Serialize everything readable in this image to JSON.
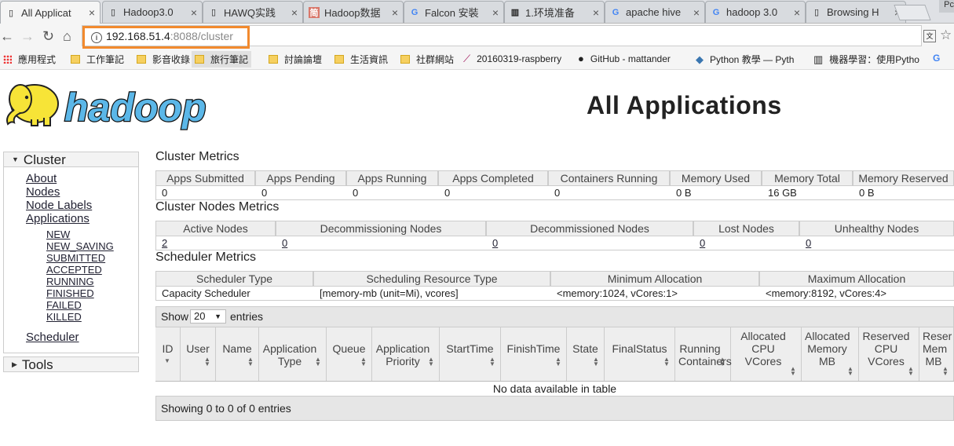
{
  "tabs": [
    {
      "label": "All Applicat",
      "icon": "page-icon",
      "active": true
    },
    {
      "label": "Hadoop3.0",
      "icon": "page-icon"
    },
    {
      "label": "HAWQ实践",
      "icon": "page-icon"
    },
    {
      "label": "Hadoop数据",
      "icon": "jian-site-icon",
      "icon_text": "简"
    },
    {
      "label": "Falcon 安裝",
      "icon": "google-icon",
      "icon_text": "G"
    },
    {
      "label": "1.环境准备",
      "icon": "book-icon"
    },
    {
      "label": "apache hive",
      "icon": "google-icon",
      "icon_text": "G"
    },
    {
      "label": "hadoop 3.0",
      "icon": "google-icon",
      "icon_text": "G"
    },
    {
      "label": "Browsing H",
      "icon": "page-icon"
    }
  ],
  "window_corner_label": "Pc",
  "address_bar": {
    "host": "192.168.51.4",
    "rest": ":8088/cluster"
  },
  "bookmarks": [
    {
      "label": "應用程式",
      "icon": "apps-icon"
    },
    {
      "label": "工作筆記",
      "icon": "folder-icon"
    },
    {
      "label": "影音收錄",
      "icon": "folder-icon"
    },
    {
      "label": "旅行筆記",
      "icon": "folder-icon",
      "selected": true
    },
    {
      "label": "討論論壇",
      "icon": "folder-icon"
    },
    {
      "label": "生活資訊",
      "icon": "folder-icon"
    },
    {
      "label": "社群網站",
      "icon": "folder-icon"
    },
    {
      "label": "20160319-raspberry",
      "icon": "feather-icon"
    },
    {
      "label": "GitHub - mattander",
      "icon": "github-icon"
    },
    {
      "label": "Python 教學 — Pyth",
      "icon": "python-icon"
    },
    {
      "label": "機器學習：使用Pytho",
      "icon": "book-icon"
    }
  ],
  "logo_text": "hadoop",
  "page_title": "All Applications",
  "sidebar": {
    "cluster_header": "Cluster",
    "links": [
      "About",
      "Nodes",
      "Node Labels",
      "Applications"
    ],
    "app_states": [
      "NEW",
      "NEW_SAVING",
      "SUBMITTED",
      "ACCEPTED",
      "RUNNING",
      "FINISHED",
      "FAILED",
      "KILLED"
    ],
    "scheduler": "Scheduler",
    "tools_header": "Tools"
  },
  "cluster_metrics": {
    "title": "Cluster Metrics",
    "headers": [
      "Apps Submitted",
      "Apps Pending",
      "Apps Running",
      "Apps Completed",
      "Containers Running",
      "Memory Used",
      "Memory Total",
      "Memory Reserved"
    ],
    "values": [
      "0",
      "0",
      "0",
      "0",
      "0",
      "0 B",
      "16 GB",
      "0 B"
    ]
  },
  "nodes_metrics": {
    "title": "Cluster Nodes Metrics",
    "headers": [
      "Active Nodes",
      "Decommissioning Nodes",
      "Decommissioned Nodes",
      "Lost Nodes",
      "Unhealthy Nodes"
    ],
    "values": [
      "2",
      "0",
      "0",
      "0",
      "0"
    ]
  },
  "scheduler_metrics": {
    "title": "Scheduler Metrics",
    "headers": [
      "Scheduler Type",
      "Scheduling Resource Type",
      "Minimum Allocation",
      "Maximum Allocation"
    ],
    "values": [
      "Capacity Scheduler",
      "[memory-mb (unit=Mi), vcores]",
      "<memory:1024, vCores:1>",
      "<memory:8192, vCores:4>"
    ]
  },
  "apps_table": {
    "show_label": "Show",
    "page_size": "20",
    "entries_label": "entries",
    "columns": [
      "ID",
      "User",
      "Name",
      "Application Type",
      "Queue",
      "Application Priority",
      "StartTime",
      "FinishTime",
      "State",
      "FinalStatus",
      "Running Containers",
      "Allocated CPU VCores",
      "Allocated Memory MB",
      "Reserved CPU VCores",
      "Reser Mem MB"
    ],
    "empty_message": "No data available in table",
    "footer": "Showing 0 to 0 of 0 entries"
  },
  "colors": {
    "url_highlight": "#f28a2e",
    "elephant": "#f7e437",
    "logo_blue": "#5bb7e8"
  }
}
